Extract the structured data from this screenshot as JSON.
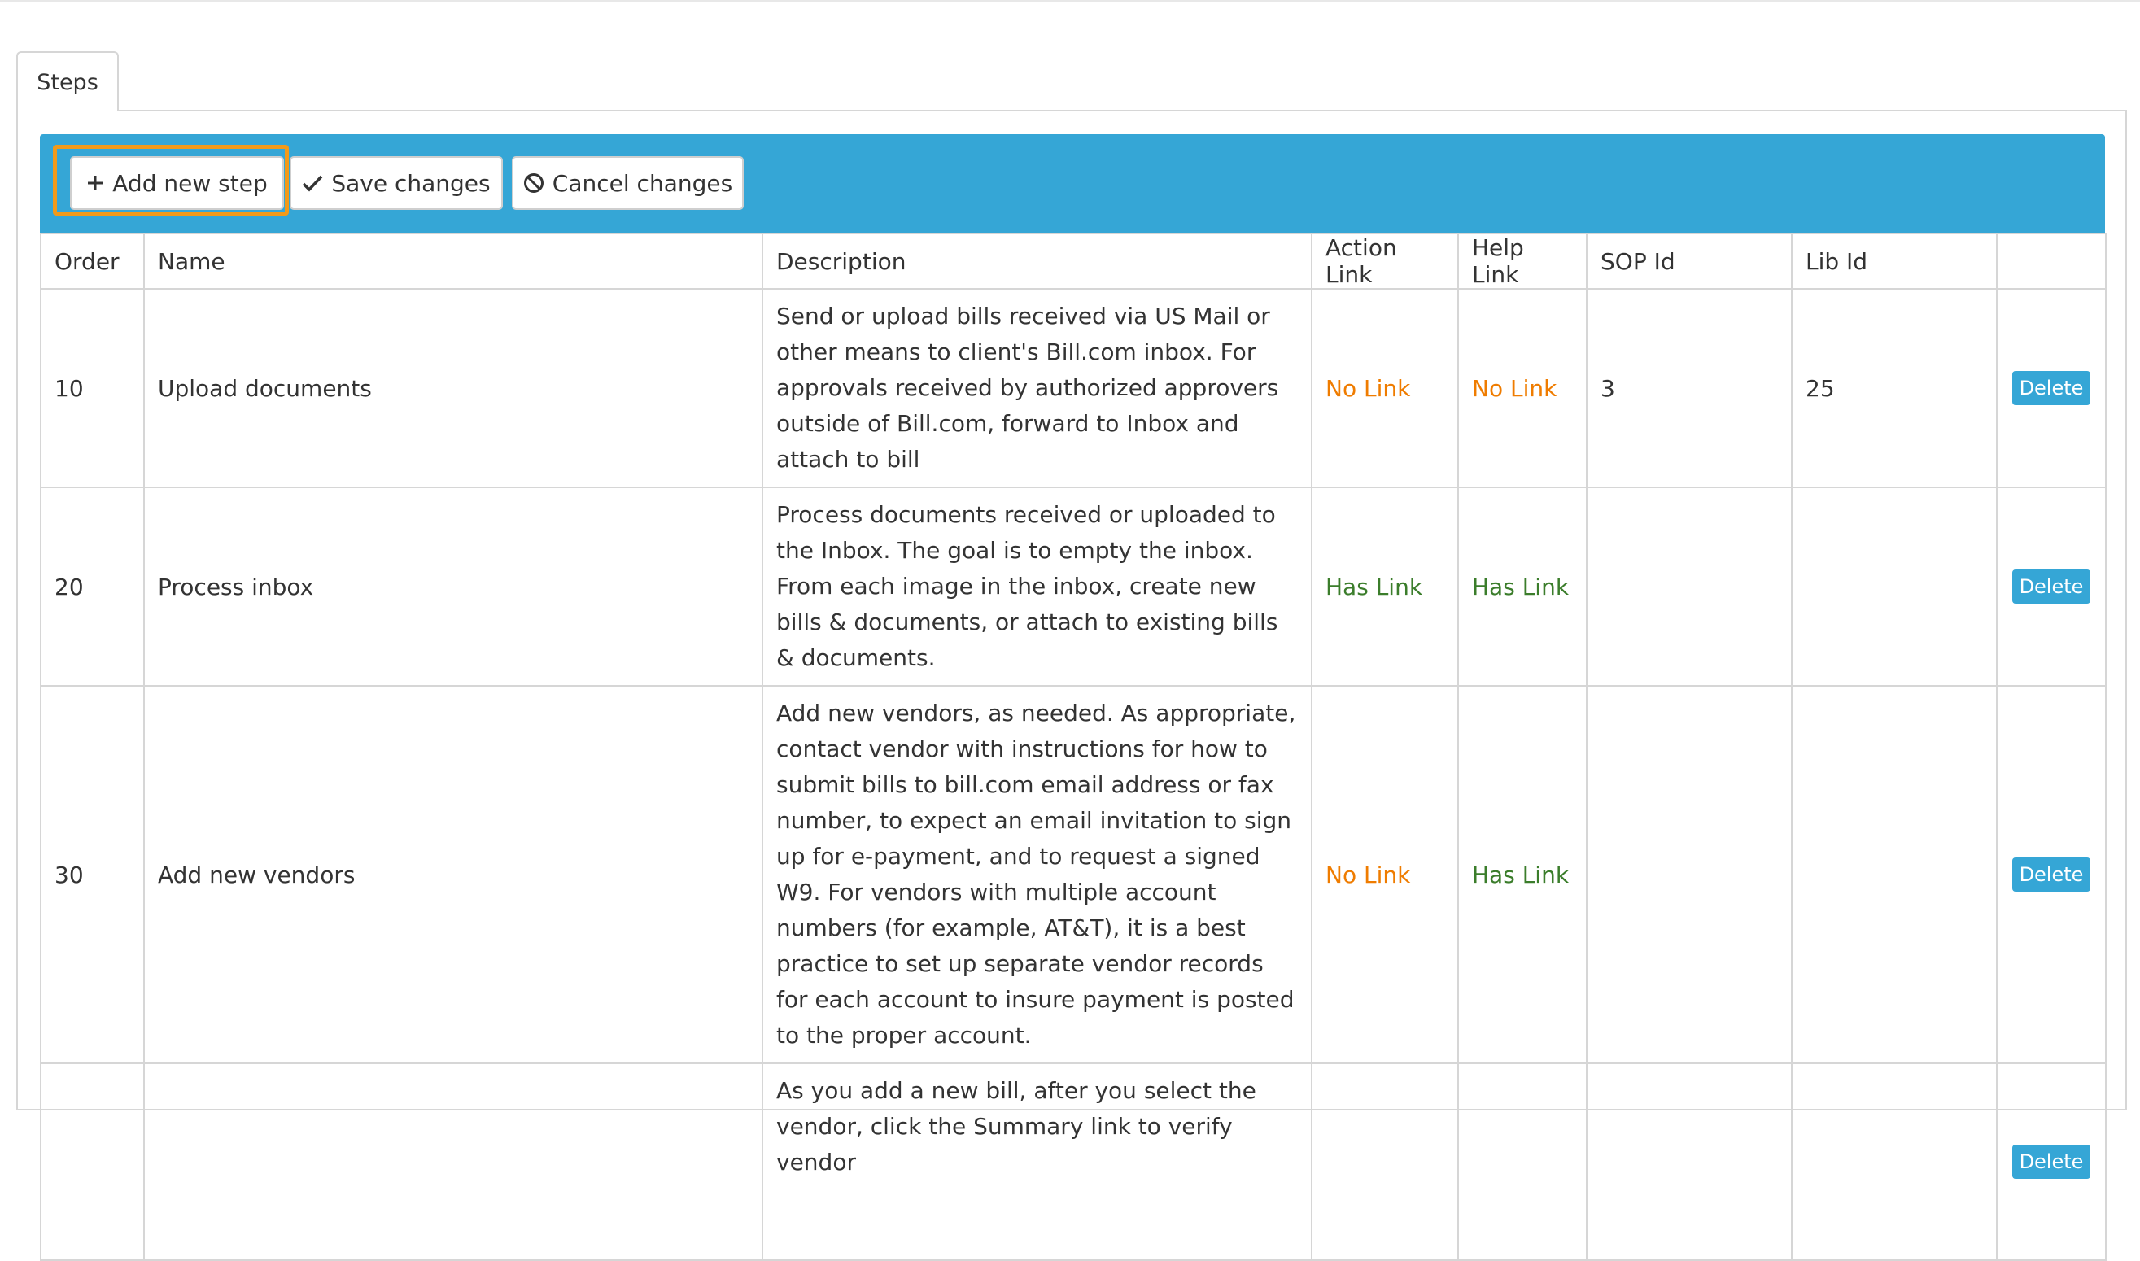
{
  "tabs": [
    {
      "label": "Steps"
    }
  ],
  "toolbar": {
    "add_label": "Add new step",
    "save_label": "Save changes",
    "cancel_label": "Cancel changes"
  },
  "table": {
    "columns": [
      "Order",
      "Name",
      "Description",
      "Action Link",
      "Help Link",
      "SOP Id",
      "Lib Id",
      ""
    ],
    "delete_label": "Delete",
    "rows": [
      {
        "order": "10",
        "name": "Upload documents",
        "description": "Send or upload bills received via US Mail or other means to client's Bill.com inbox. For approvals received by authorized approvers outside of Bill.com, forward to Inbox and attach to bill",
        "action_link": "No Link",
        "help_link": "No Link",
        "sop_id": "3",
        "lib_id": "25"
      },
      {
        "order": "20",
        "name": "Process inbox",
        "description": "Process documents received or uploaded to the Inbox. The goal is to empty the inbox. From each image in the inbox, create new bills & documents, or attach to existing bills & documents.",
        "action_link": "Has Link",
        "help_link": "Has Link",
        "sop_id": "",
        "lib_id": ""
      },
      {
        "order": "30",
        "name": "Add new vendors",
        "description": "Add new vendors, as needed. As appropriate, contact vendor with instructions for how to submit bills to bill.com email address or fax number, to expect an email invitation to sign up for e-payment, and to request a signed W9. For vendors with multiple account numbers (for example, AT&T), it is a best practice to set up separate vendor records for each account to insure payment is posted to the proper account.",
        "action_link": "No Link",
        "help_link": "Has Link",
        "sop_id": "",
        "lib_id": ""
      },
      {
        "order": "",
        "name": "",
        "description": "As you add a new bill, after you select the vendor, click the Summary link to verify vendor",
        "action_link": "",
        "help_link": "",
        "sop_id": "",
        "lib_id": ""
      }
    ]
  },
  "colors": {
    "toolbar": "#35a6d6",
    "no_link": "#ef7c00",
    "has_link": "#3b7d2b",
    "focus_outline": "#f19a1a"
  },
  "icons": {
    "add": "plus-icon",
    "save": "check-icon",
    "cancel": "cancel-icon"
  }
}
